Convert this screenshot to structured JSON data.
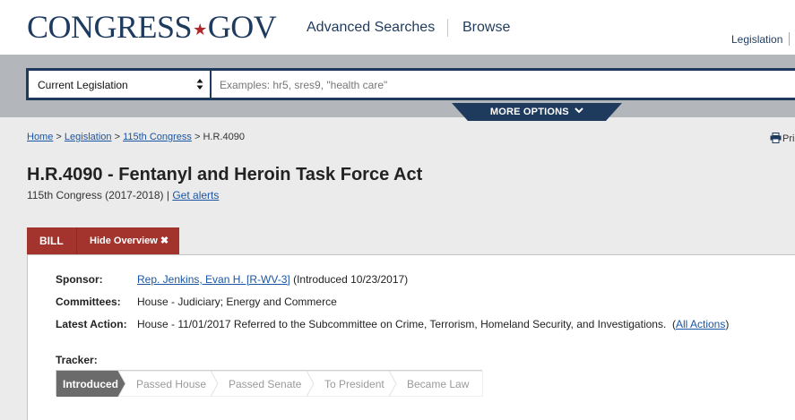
{
  "header": {
    "logo_left": "CONGRESS",
    "logo_star": "★",
    "logo_right": "GOV",
    "nav": [
      "Advanced Searches",
      "Browse"
    ],
    "nav_right": "Legislation"
  },
  "search": {
    "select_value": "Current Legislation",
    "placeholder": "Examples: hr5, sres9, \"health care\"",
    "more_options": "MORE OPTIONS"
  },
  "breadcrumb": {
    "items": [
      "Home",
      "Legislation",
      "115th Congress"
    ],
    "current": "H.R.4090",
    "separator": ">"
  },
  "print_label": "Pri",
  "bill": {
    "title": "H.R.4090 - Fentanyl and Heroin Task Force Act",
    "congress": "115th Congress (2017-2018)",
    "get_alerts": "Get alerts"
  },
  "tabs": {
    "bill": "BILL",
    "hide_overview": "Hide Overview ✖"
  },
  "overview": {
    "sponsor_label": "Sponsor:",
    "sponsor_link": "Rep. Jenkins, Evan H. [R-WV-3]",
    "sponsor_intro": "(Introduced 10/23/2017)",
    "committees_label": "Committees:",
    "committees_value": "House - Judiciary; Energy and Commerce",
    "latest_action_label": "Latest Action:",
    "latest_action_value": "House - 11/01/2017 Referred to the Subcommittee on Crime, Terrorism, Homeland Security, and Investigations.",
    "all_actions": "All Actions",
    "tracker_label": "Tracker:"
  },
  "tracker": {
    "steps": [
      "Introduced",
      "Passed House",
      "Passed Senate",
      "To President",
      "Became Law"
    ],
    "active_index": 0
  },
  "colors": {
    "brand_navy": "#1e3b5e",
    "brand_red": "#a2342d",
    "link": "#1a55a3"
  }
}
